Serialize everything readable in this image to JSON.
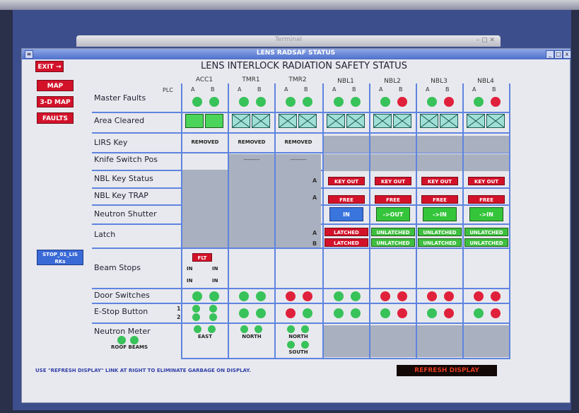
{
  "terminal_title": "Terminal",
  "window_title": "LENS RADSAF STATUS",
  "window_controls": [
    "_",
    "□",
    "x"
  ],
  "exit_label": "EXIT",
  "left_buttons": [
    "MAP",
    "3-D MAP",
    "FAULTS"
  ],
  "stop_button": {
    "line1": "STOP_01_LIS",
    "line2": "RKs"
  },
  "main_title": "LENS INTERLOCK RADIATION SAFETY STATUS",
  "plc_label": "PLC",
  "columns": [
    "ACC1",
    "TMR1",
    "TMR2",
    "NBL1",
    "NBL2",
    "NBL3",
    "NBL4"
  ],
  "ab_labels": [
    "A",
    "B"
  ],
  "row_labels": {
    "master_faults": "Master Faults",
    "area_cleared": "Area Cleared",
    "lirs_key": "LIRS Key",
    "knife_switch": "Knife Switch Pos",
    "nbl_key_status": "NBL Key Status",
    "nbl_key_trap": "NBL Key TRAP",
    "neutron_shutter": "Neutron Shutter",
    "latch": "Latch",
    "beam_stops": "Beam Stops",
    "door_switches": "Door Switches",
    "estop_button": "E-Stop Button",
    "neutron_meter": "Neutron Meter",
    "roof_beams": "ROOF BEAMS"
  },
  "row_side_labels": {
    "key_a": "A",
    "trap_a": "A",
    "latch_a": "A",
    "latch_b": "B",
    "estop_1": "1",
    "estop_2": "2"
  },
  "master_faults": [
    [
      "green",
      "green"
    ],
    [
      "green",
      "green"
    ],
    [
      "green",
      "green"
    ],
    [
      "green",
      "green"
    ],
    [
      "green",
      "red"
    ],
    [
      "green",
      "red"
    ],
    [
      "green",
      "red"
    ]
  ],
  "lirs_key": [
    "REMOVED",
    "REMOVED",
    "REMOVED"
  ],
  "knife_switch": [
    "---------",
    "---------"
  ],
  "nbl_key_status": [
    "KEY OUT",
    "KEY OUT",
    "KEY OUT",
    "KEY OUT"
  ],
  "nbl_key_trap": [
    "FREE",
    "FREE",
    "FREE",
    "FREE"
  ],
  "neutron_shutter": [
    "IN",
    "->OUT",
    "->IN",
    "->IN"
  ],
  "latch_a": [
    "LATCHED",
    "UNLATCHED",
    "UNLATCHED",
    "UNLATCHED"
  ],
  "latch_b": [
    "LATCHED",
    "UNLATCHED",
    "UNLATCHED",
    "UNLATCHED"
  ],
  "beam_stops": {
    "flt": "FLT",
    "labels": [
      "IN",
      "IN",
      "IN",
      "IN"
    ]
  },
  "door_switches": [
    [
      "green",
      "green"
    ],
    [
      "green",
      "green"
    ],
    [
      "red",
      "red"
    ],
    [
      "green",
      "green"
    ],
    [
      "red",
      "red"
    ],
    [
      "red",
      "red"
    ],
    [
      "red",
      "red"
    ]
  ],
  "estop": [
    [
      "green",
      "green"
    ],
    [
      "green",
      "green"
    ],
    [
      "red",
      "green"
    ],
    [
      "green",
      "green"
    ],
    [
      "green",
      "red"
    ],
    [
      "green",
      "red"
    ],
    [
      "green",
      "red"
    ]
  ],
  "neutron_meter_labels": [
    "EAST",
    "NORTH",
    "NORTH",
    "SOUTH"
  ],
  "footer_note": "USE \"REFRESH DISPLAY\" LINK AT RIGHT TO ELIMINATE GARBAGE ON DISPLAY.",
  "refresh_label": "REFRESH DISPLAY",
  "colors": {
    "green": "#38c25a",
    "red": "#e0213b",
    "accent_blue": "#5f84e0"
  }
}
